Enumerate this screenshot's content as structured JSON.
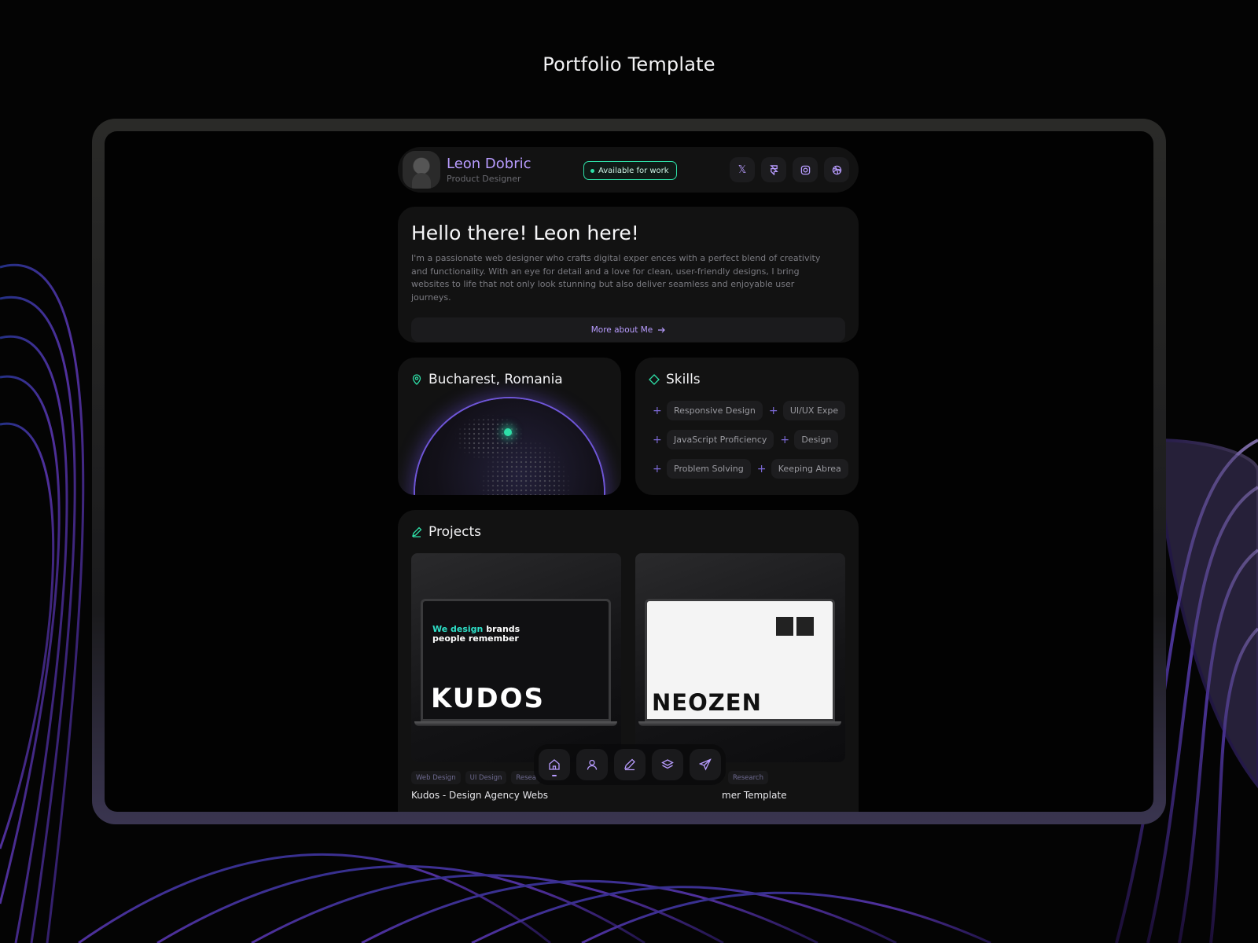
{
  "page": {
    "title": "Portfolio Template"
  },
  "profile": {
    "name": "Leon Dobric",
    "role": "Product Designer",
    "status": "Available for work"
  },
  "socials": [
    {
      "icon": "x-icon",
      "label": "𝕏"
    },
    {
      "icon": "framer-icon",
      "label": ""
    },
    {
      "icon": "instagram-icon",
      "label": ""
    },
    {
      "icon": "dribbble-icon",
      "label": ""
    }
  ],
  "intro": {
    "heading": "Hello there! Leon here!",
    "body": "I'm a passionate web designer who crafts digital exper ences with a perfect blend of creativity and functionality. With an eye for detail and a love for clean, user-friendly designs, I bring websites to life that not only look stunning but also deliver seamless and enjoyable user journeys.",
    "button": "More about Me"
  },
  "location": {
    "title": "Bucharest, Romania"
  },
  "skills": {
    "title": "Skills",
    "rows": [
      [
        "Responsive Design",
        "UI/UX Expe"
      ],
      [
        "JavaScript Proficiency",
        "Design"
      ],
      [
        "Problem Solving",
        "Keeping Abrea"
      ]
    ]
  },
  "projects": {
    "title": "Projects",
    "items": [
      {
        "screen_headline_a": "We design",
        "screen_headline_b": "brands",
        "screen_headline_c": "people remember",
        "screen_logo": "KUDOS",
        "tags": [
          "Web Design",
          "UI Design",
          "Resea"
        ],
        "title": "Kudos - Design Agency Webs"
      },
      {
        "screen_logo": "NEOZEN",
        "tags": [
          "Research"
        ],
        "title": "mer Template"
      }
    ]
  },
  "dock": [
    {
      "icon": "home-icon",
      "active": true
    },
    {
      "icon": "user-icon",
      "active": false
    },
    {
      "icon": "pen-icon",
      "active": false
    },
    {
      "icon": "layers-icon",
      "active": false
    },
    {
      "icon": "send-icon",
      "active": false
    }
  ],
  "colors": {
    "accent": "#b89cff",
    "green": "#2ee0a8",
    "card": "#121212"
  }
}
